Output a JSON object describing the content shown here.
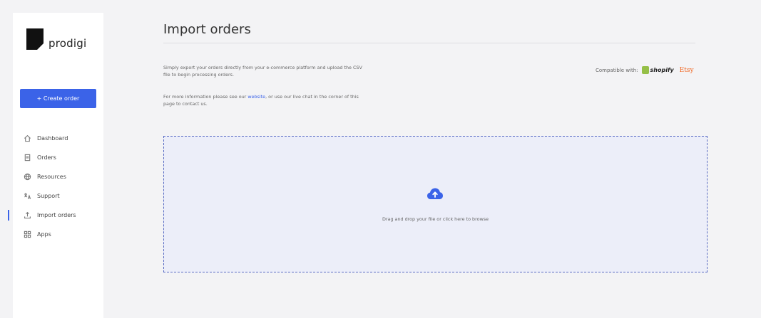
{
  "sidebar": {
    "logo_text": "prodigi",
    "create_button": "+ Create order",
    "items": [
      {
        "label": "Dashboard",
        "icon": "home-icon"
      },
      {
        "label": "Orders",
        "icon": "document-icon"
      },
      {
        "label": "Resources",
        "icon": "globe-icon"
      },
      {
        "label": "Support",
        "icon": "support-icon"
      },
      {
        "label": "Import orders",
        "icon": "upload-icon"
      },
      {
        "label": "Apps",
        "icon": "apps-icon"
      }
    ]
  },
  "main": {
    "title": "Import orders",
    "intro_text": "Simply export your orders directly from your e-commerce platform and upload the CSV file to begin processing orders.",
    "more_info_prefix": "For more information please see our ",
    "more_info_link": "website",
    "more_info_suffix": ", or use our live chat in the corner of this page to contact us.",
    "compatible_label": "Compatible with:",
    "shopify_label": "shopify",
    "etsy_label": "Etsy",
    "dropzone_text": "Drag and drop your file or click here to browse"
  },
  "colors": {
    "accent": "#3b63e8",
    "dropzone_bg": "#eceef9",
    "dropzone_border": "#5a6cc4",
    "shopify_green": "#95bf47",
    "etsy_orange": "#f1641e"
  }
}
